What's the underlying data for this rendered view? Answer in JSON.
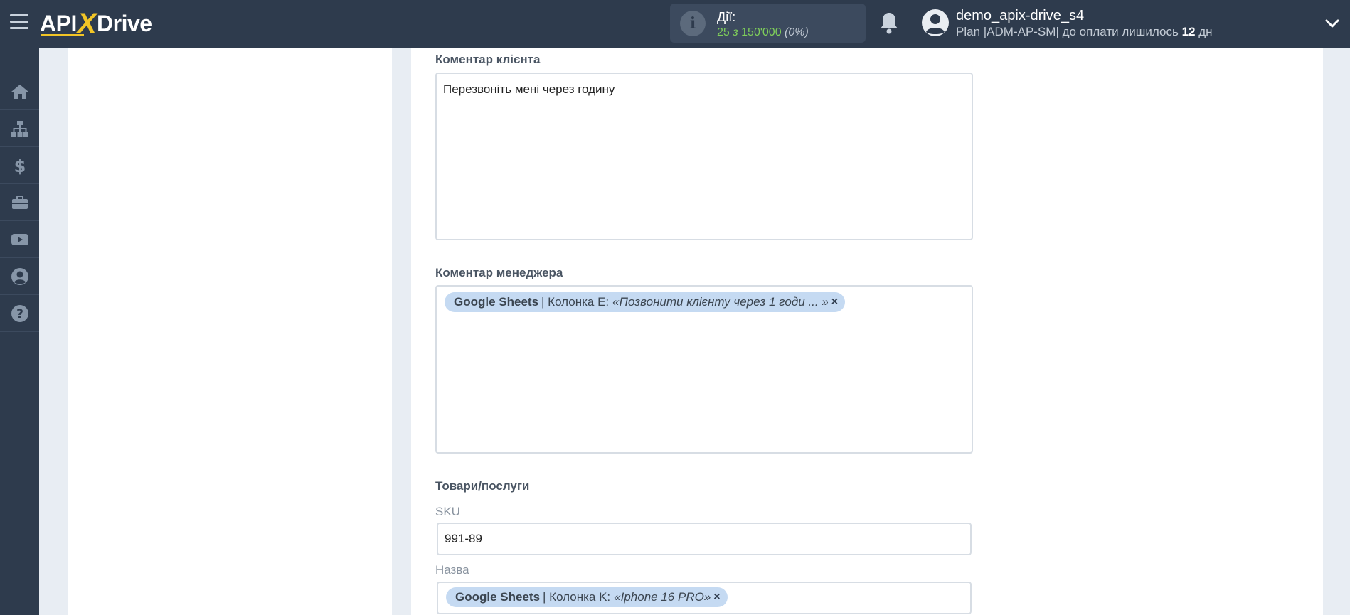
{
  "header": {
    "logo": {
      "api": "API",
      "x": "X",
      "drive": "Drive"
    },
    "actions": {
      "title": "Дії:",
      "used": "25",
      "of": "з",
      "limit": "150'000",
      "percent": "(0%)"
    },
    "user": {
      "name": "demo_apix-drive_s4",
      "plan_prefix": "Plan |ADM-AP-SM| до оплати лишилось",
      "days_left": "12",
      "days_unit": "дн"
    }
  },
  "sidebar": {
    "items": [
      {
        "icon": "home-icon"
      },
      {
        "icon": "sitemap-icon"
      },
      {
        "icon": "dollar-icon"
      },
      {
        "icon": "briefcase-icon"
      },
      {
        "icon": "youtube-icon"
      },
      {
        "icon": "user-circle-icon"
      },
      {
        "icon": "help-icon"
      }
    ]
  },
  "form": {
    "client_comment": {
      "label": "Коментар клієнта",
      "value": "Перезвоніть мені через годину"
    },
    "manager_comment": {
      "label": "Коментар менеджера",
      "chip": {
        "source": "Google Sheets",
        "column": "| Колонка E:",
        "value": "«Позвонити клієнту через 1 годи ... »",
        "remove": "×"
      }
    },
    "products": {
      "label": "Товари/послуги",
      "sku_label": "SKU",
      "sku_value": "991-89",
      "name_label": "Назва",
      "name_chip": {
        "source": "Google Sheets",
        "column": "| Колонка K:",
        "value": "«Iphone 16 PRO»",
        "remove": "×"
      }
    }
  },
  "colors": {
    "topbar": "#2e3b4d",
    "accent": "#f2c526",
    "chip_bg": "#c5daf2",
    "actions_count": "#7fcf5a"
  }
}
